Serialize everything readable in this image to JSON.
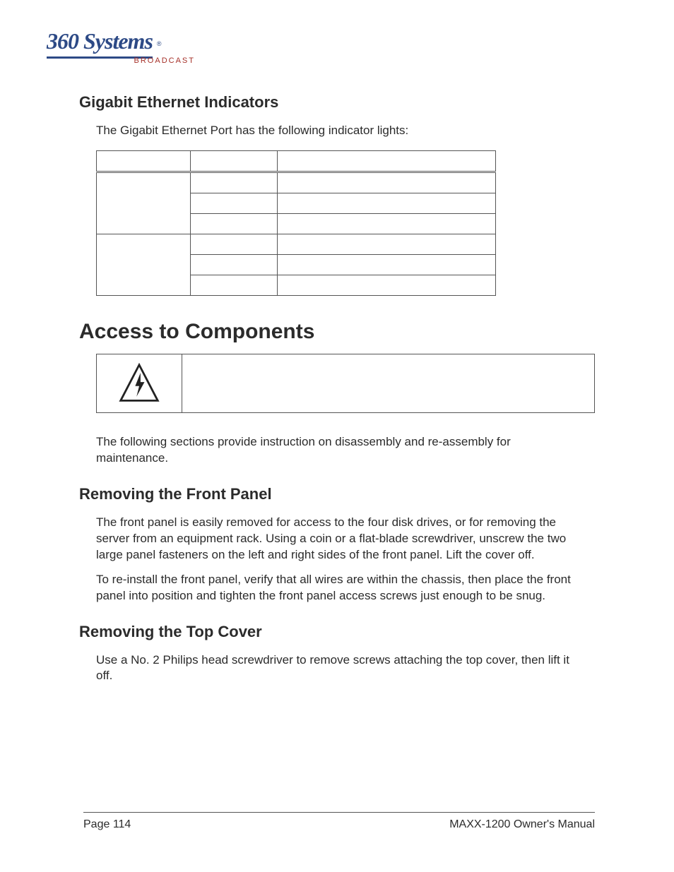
{
  "logo": {
    "script_text": "360 Systems",
    "broadcast_text": "BROADCAST"
  },
  "sec1": {
    "heading": "Gigabit Ethernet Indicators",
    "intro": "The Gigabit Ethernet Port has the following indicator lights:"
  },
  "table": {
    "headers": [
      "",
      "",
      ""
    ],
    "rows": [
      [
        "",
        "",
        ""
      ],
      [
        "",
        "",
        ""
      ],
      [
        "",
        "",
        ""
      ],
      [
        "",
        "",
        ""
      ],
      [
        "",
        "",
        ""
      ],
      [
        "",
        "",
        ""
      ]
    ]
  },
  "sec2": {
    "heading": "Access to Components",
    "intro": "The following sections provide instruction on disassembly and re-assembly for maintenance."
  },
  "sec3": {
    "heading": "Removing the Front Panel",
    "p1": "The front panel is easily removed for access to the four disk drives, or for removing the server from an equipment rack.  Using a coin or a flat-blade screwdriver, unscrew the two large panel fasteners on the left and right sides of the front panel. Lift the cover off.",
    "p2": "To re-install the front panel, verify that all wires are within the chassis, then place the front panel into position and tighten the front panel access screws just enough to be snug."
  },
  "sec4": {
    "heading": "Removing the Top Cover",
    "p1": "Use a No. 2 Philips head screwdriver to remove screws attaching the top cover, then lift it off."
  },
  "footer": {
    "left": "Page 114",
    "right": "MAXX-1200 Owner's Manual"
  }
}
